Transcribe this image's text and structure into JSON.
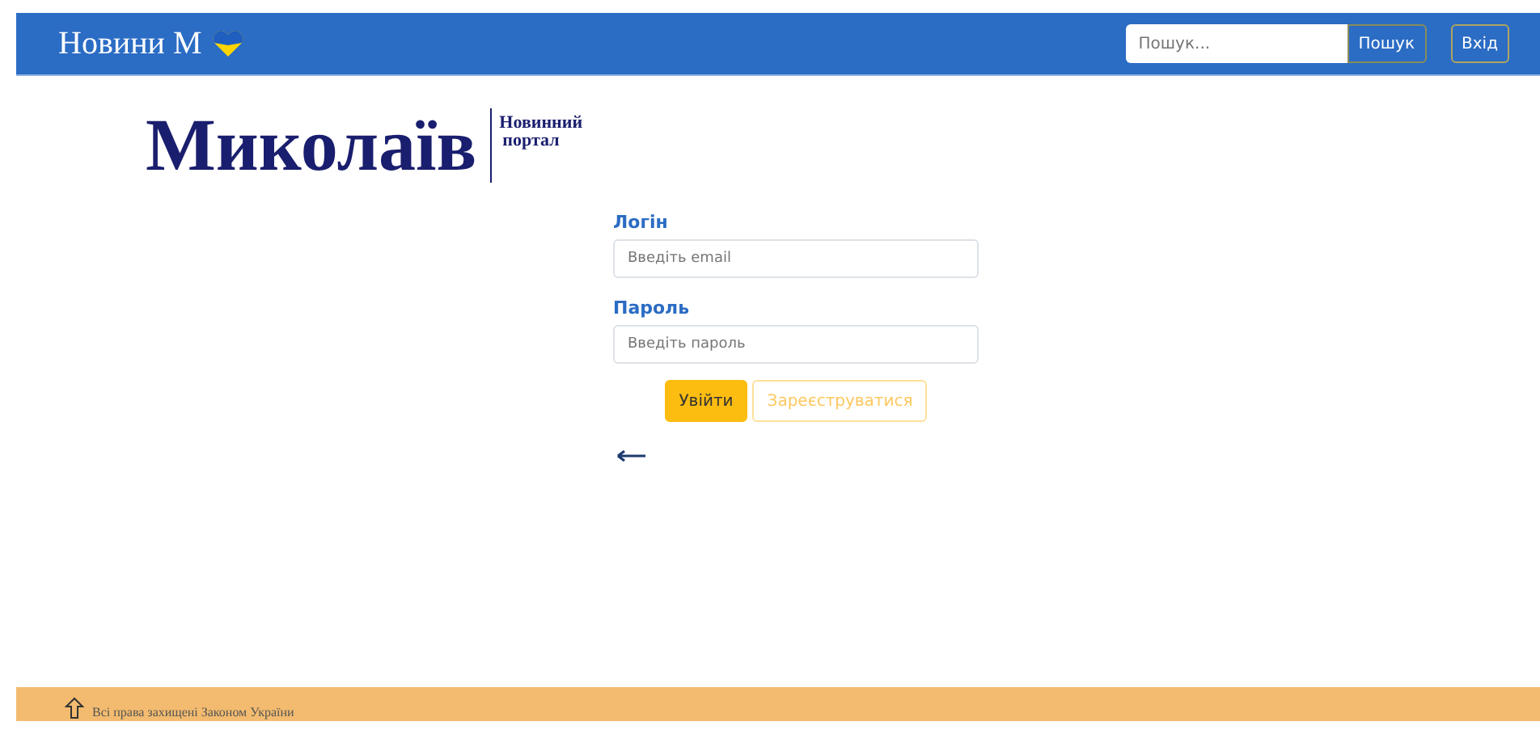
{
  "navbar": {
    "brand": "Новини М",
    "search": {
      "placeholder": "Пошук..."
    },
    "search_button": "Пошук",
    "login_button": "Вхід"
  },
  "logo": {
    "title": "Миколаїв",
    "subtitle_1": "Новинний",
    "subtitle_2": "портал"
  },
  "form": {
    "fields": [
      {
        "label": "Логін",
        "placeholder": "Введіть email"
      },
      {
        "label": "Пароль",
        "placeholder": "Введіть пароль"
      }
    ],
    "buttons": [
      {
        "label": "Увійти",
        "kind": "primary"
      },
      {
        "label": "Зареєструватися",
        "kind": "outline"
      }
    ]
  },
  "footer": {
    "text": "Всі права захищені Законом України"
  }
}
